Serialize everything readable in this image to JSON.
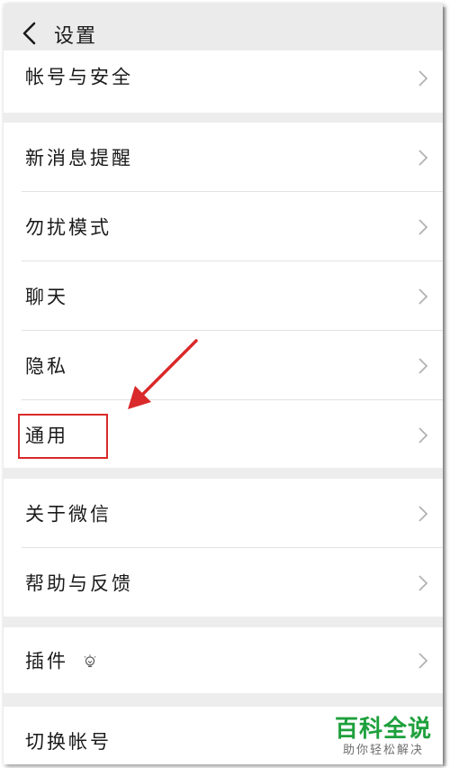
{
  "header": {
    "title": "设置",
    "back_icon": "chevron-left-icon"
  },
  "groups": [
    {
      "items": [
        {
          "label": "帐号与安全"
        }
      ]
    },
    {
      "items": [
        {
          "label": "新消息提醒"
        },
        {
          "label": "勿扰模式"
        },
        {
          "label": "聊天"
        },
        {
          "label": "隐私"
        },
        {
          "label": "通用",
          "highlighted": true
        }
      ]
    },
    {
      "items": [
        {
          "label": "关于微信"
        },
        {
          "label": "帮助与反馈"
        }
      ]
    },
    {
      "items": [
        {
          "label": "插件",
          "icon": "lightbulb-icon"
        }
      ]
    },
    {
      "items": [
        {
          "label": "切换帐号"
        }
      ]
    }
  ],
  "annotation": {
    "highlight_color": "#d9292a",
    "arrow_color": "#d9292a",
    "points_to": "通用"
  },
  "watermark": {
    "title": "百科全说",
    "subtitle": "助你轻松解决",
    "color": "#1ea03c"
  },
  "colors": {
    "background": "#ededed",
    "row_background": "#ffffff",
    "chevron": "#b2b2b2"
  }
}
